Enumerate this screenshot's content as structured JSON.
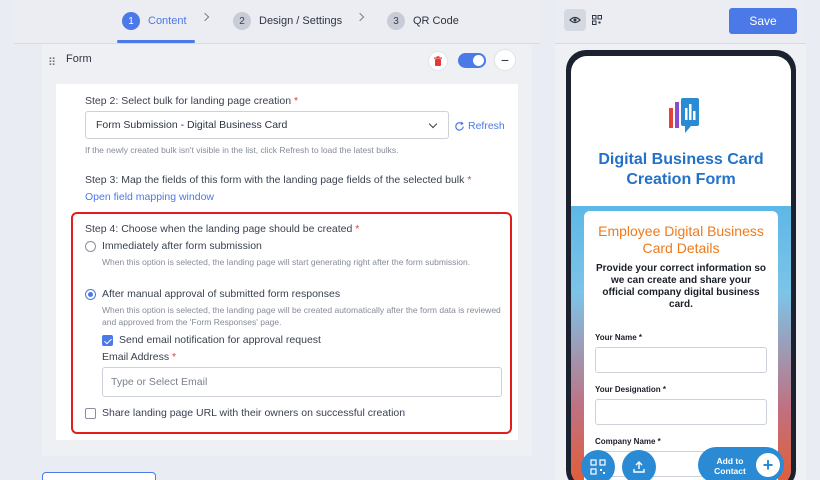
{
  "steps": [
    {
      "num": "1",
      "label": "Content"
    },
    {
      "num": "2",
      "label": "Design / Settings"
    },
    {
      "num": "3",
      "label": "QR Code"
    }
  ],
  "form": {
    "title": "Form",
    "step2": {
      "label": "Step 2: Select bulk for landing page creation",
      "required": "*",
      "selected": "Form Submission - Digital Business Card",
      "refresh": "Refresh",
      "hint": "If the newly created bulk isn't visible in the list, click Refresh to load the latest bulks."
    },
    "step3": {
      "label": "Step 3: Map the fields of this form with the landing page fields of the selected bulk",
      "required": "*",
      "link": "Open field mapping window"
    },
    "step4": {
      "label": "Step 4: Choose when the landing page should be created",
      "required": "*",
      "option1": "Immediately after form submission",
      "option1_hint": "When this option is selected, the landing page will start generating right after the form submission.",
      "option2": "After manual approval of submitted form responses",
      "option2_hint": "When this option is selected, the landing page will be created automatically after the form data is reviewed and approved from the 'Form Responses' page.",
      "email_notify": "Send email notification for approval request",
      "email_label": "Email Address",
      "email_required": "*",
      "email_placeholder": "Type or Select Email",
      "share": "Share landing page URL with their owners on successful creation"
    }
  },
  "preview": {
    "save": "Save",
    "title": "Digital Business Card Creation Form",
    "card_title": "Employee Digital Business Card Details",
    "card_desc": "Provide your correct information so we can create and share your official company digital business card.",
    "field1": "Your Name *",
    "field2": "Your Designation *",
    "field3": "Company Name *",
    "add_contact": "Add to Contact"
  },
  "colors": {
    "accent": "#4b79e8",
    "highlight": "#e01e1e",
    "title_blue": "#2371c9",
    "card_orange": "#f07a1a"
  }
}
